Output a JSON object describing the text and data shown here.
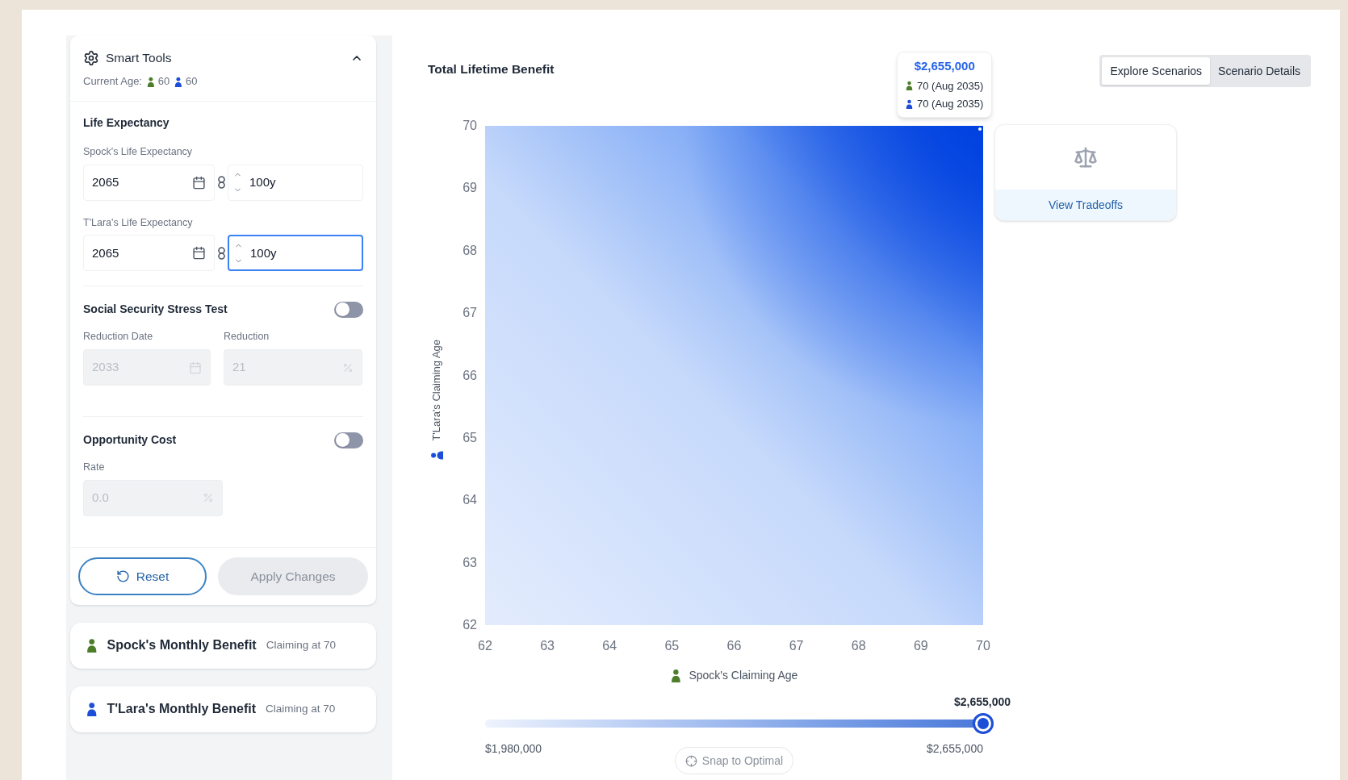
{
  "smart_tools": {
    "title": "Smart Tools",
    "expanded": true,
    "current_age_label": "Current Age:",
    "people": [
      {
        "age": "60",
        "color": "#4d7c2a"
      },
      {
        "age": "60",
        "color": "#1d4ed8"
      }
    ]
  },
  "life_expectancy": {
    "title": "Life Expectancy",
    "entries": [
      {
        "label": "Spock's Life Expectancy",
        "date": "2065",
        "years": "100y",
        "focused": false
      },
      {
        "label": "T'Lara's Life Expectancy",
        "date": "2065",
        "years": "100y",
        "focused": true
      }
    ]
  },
  "stress_test": {
    "title": "Social Security Stress Test",
    "on": false,
    "fields": [
      {
        "label": "Reduction Date",
        "value": "2033",
        "kind": "date",
        "disabled": true
      },
      {
        "label": "Reduction",
        "value": "21",
        "kind": "percent",
        "disabled": true
      }
    ]
  },
  "opportunity_cost": {
    "title": "Opportunity Cost",
    "on": false,
    "fields": [
      {
        "label": "Rate",
        "value": "0.0",
        "kind": "percent",
        "disabled": true
      }
    ]
  },
  "actions": [
    {
      "label": "Reset",
      "kind": "reset",
      "disabled": false
    },
    {
      "label": "Apply Changes",
      "kind": "apply",
      "disabled": true
    }
  ],
  "benefits": [
    {
      "title": "Spock's Monthly Benefit",
      "note": "Claiming at 70",
      "color": "#4d7c2a"
    },
    {
      "title": "T'Lara's Monthly Benefit",
      "note": "Claiming at 70",
      "color": "#1d4ed8"
    }
  ],
  "chart": {
    "title": "Total Lifetime Benefit",
    "y_axis_label": "T'Lara's Claiming Age",
    "x_axis_label": "Spock's Claiming Age",
    "y_ticks": [
      "70",
      "69",
      "68",
      "67",
      "66",
      "65",
      "64",
      "63",
      "62"
    ],
    "x_ticks": [
      "62",
      "63",
      "64",
      "65",
      "66",
      "67",
      "68",
      "69",
      "70"
    ]
  },
  "tooltip": {
    "value": "$2,655,000",
    "lines": [
      {
        "text": "70 (Aug 2035)",
        "color": "#4d7c2a"
      },
      {
        "text": "70 (Aug 2035)",
        "color": "#1d4ed8"
      }
    ]
  },
  "tabs": [
    {
      "label": "Explore Scenarios",
      "selected": true
    },
    {
      "label": "Scenario Details",
      "selected": false
    }
  ],
  "tradeoffs": {
    "label": "View Tradeoffs"
  },
  "benefit_slider": {
    "value": "$2,655,000",
    "level": 1,
    "min": "$1,980,000",
    "max": "$2,655,000",
    "snap_label": "Snap to Optimal",
    "snap_disabled": true
  }
}
